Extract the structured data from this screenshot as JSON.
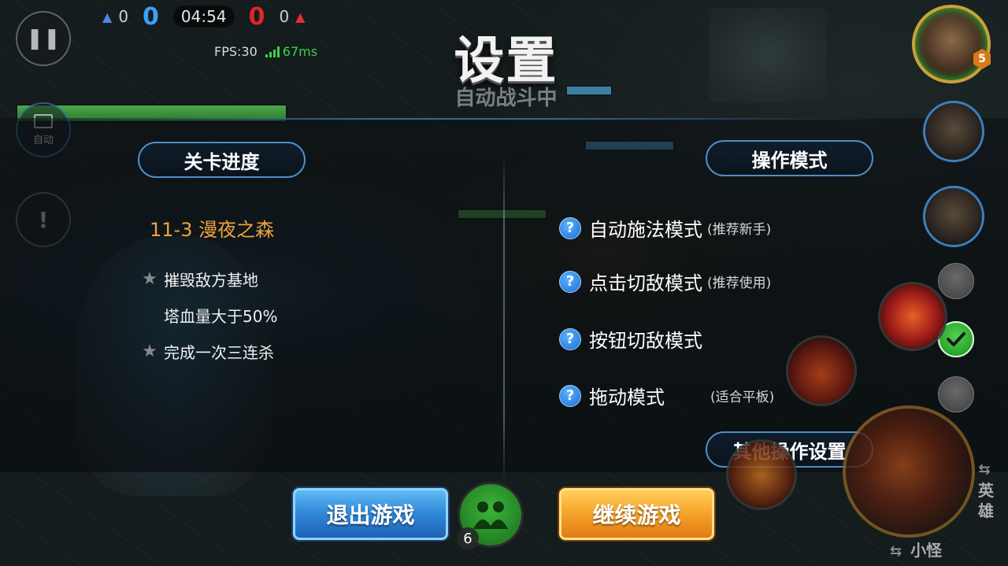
{
  "hud": {
    "blue_towers": "0",
    "blue_kills": "0",
    "timer": "04:54",
    "red_kills": "0",
    "red_towers": "0",
    "fps_label": "FPS:30",
    "ping": "67ms",
    "auto_label": "自动"
  },
  "header": {
    "title": "设置",
    "subtitle": "自动战斗中"
  },
  "stage": {
    "heading": "关卡进度",
    "level": "11-3 漫夜之森",
    "objectives": [
      {
        "text": "摧毁敌方基地",
        "starred": true
      },
      {
        "text": "塔血量大于50%",
        "starred": false
      },
      {
        "text": "完成一次三连杀",
        "starred": true
      }
    ]
  },
  "controls": {
    "heading": "操作模式",
    "modes": [
      {
        "label": "自动施法模式",
        "note": "(推荐新手)",
        "selected": false
      },
      {
        "label": "点击切敌模式",
        "note": "(推荐使用)",
        "selected": false
      },
      {
        "label": "按钮切敌模式",
        "note": "",
        "selected": true
      },
      {
        "label": "拖动模式",
        "note": "(适合平板)",
        "selected": false
      }
    ],
    "other_settings": "其他操作设置"
  },
  "buttons": {
    "exit": "退出游戏",
    "continue": "继续游戏",
    "team_count": "6"
  },
  "side": {
    "hero_level": "5",
    "hero_label": "英雄",
    "minion_label": "小怪"
  },
  "colors": {
    "accent_blue": "#4f8ec4",
    "level_orange": "#f0a23a",
    "exit_blue": "#2f86d6",
    "continue_orange": "#f5a22a",
    "check_green": "#3ab53a",
    "blue_team": "#3aa0ff",
    "red_team": "#e02626"
  },
  "icons": {
    "pause": "pause-icon",
    "auto": "monitor-icon",
    "alert": "exclamation-icon",
    "help": "question-icon",
    "check": "check-icon",
    "team": "team-icon",
    "star": "star-icon",
    "swap": "swap-icon"
  }
}
